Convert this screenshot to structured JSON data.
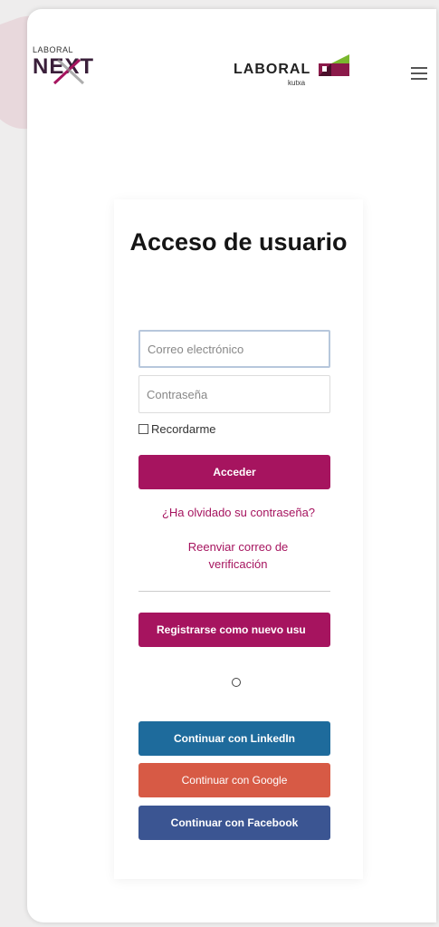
{
  "header": {
    "next_logo_small": "LABORAL",
    "next_logo_big": "NEXT",
    "kutxa_logo_word": "LABORAL",
    "kutxa_logo_sub": "kutxa",
    "menu_icon": "hamburger-icon"
  },
  "login": {
    "title": "Acceso de usuario",
    "email_placeholder": "Correo electrónico",
    "password_placeholder": "Contraseña",
    "remember_label": "Recordarme",
    "submit_label": "Acceder",
    "forgot_link": "¿Ha olvidado su contraseña?",
    "resend_link": "Reenviar correo de verificación",
    "register_label": "Registrarse como nuevo usu",
    "linkedin_label": "Continuar con LinkedIn",
    "google_label": "Continuar con Google",
    "facebook_label": "Continuar con Facebook"
  },
  "colors": {
    "primary": "#a6145f",
    "linkedin": "#1e6b9c",
    "google": "#d75a45",
    "facebook": "#3b5592"
  }
}
